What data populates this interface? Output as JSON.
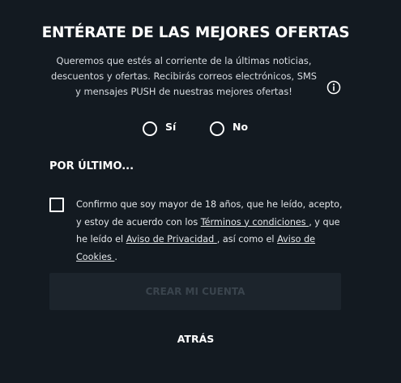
{
  "header": {
    "title": "ENTÉRATE DE LAS MEJORES OFERTAS"
  },
  "offers": {
    "description": "Queremos que estés al corriente de la últimas noticias, descuentos y ofertas. Recibirás correos electrónicos, SMS y mensajes PUSH de nuestras mejores ofertas!",
    "info_icon": "info-circle-icon",
    "option_yes": "Sí",
    "option_no": "No"
  },
  "final": {
    "section_title": "POR ÚLTIMO...",
    "consent_part1": "Confirmo que soy mayor de 18 años, que he leído, acepto, y estoy de acuerdo con los ",
    "terms_link": "Términos y condiciones ",
    "consent_part2": ", y que he leído el ",
    "privacy_link": "Aviso de Privacidad ",
    "consent_part3": ", así como el ",
    "cookies_link": "Aviso de Cookies ",
    "consent_part4": "."
  },
  "actions": {
    "create_account": "CREAR MI CUENTA",
    "back": "ATRÁS"
  },
  "colors": {
    "background": "#131a21",
    "button_disabled_bg": "#1c242c",
    "button_disabled_text": "#3a444d",
    "text": "#ffffff"
  }
}
